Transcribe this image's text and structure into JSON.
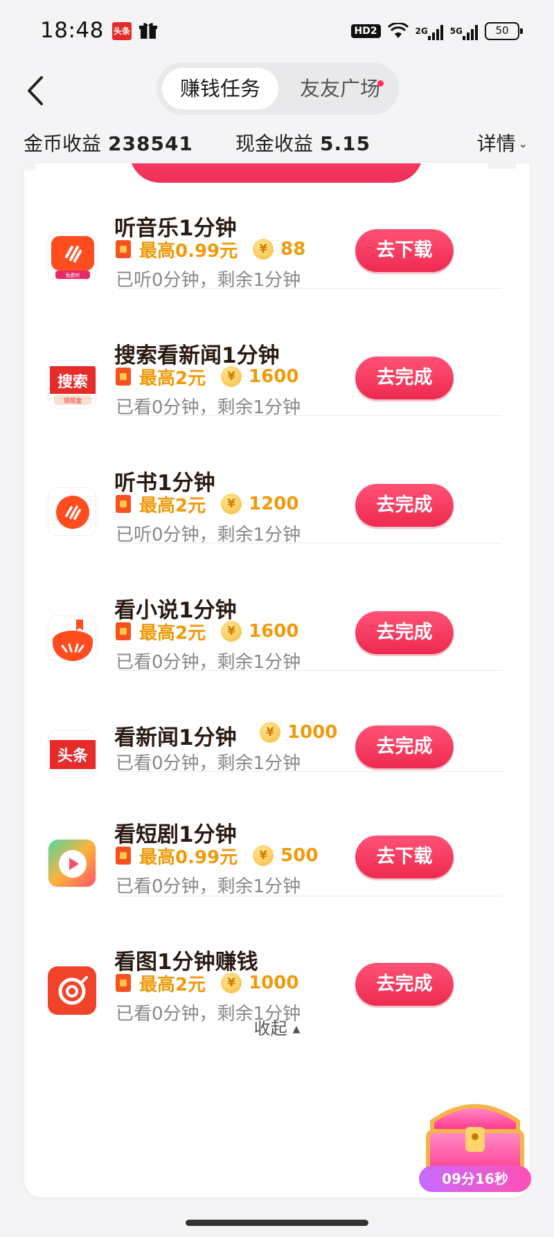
{
  "status_bar": {
    "time": "18:48",
    "app_badge": "头条",
    "hd_label": "HD2",
    "signal1_label": "2G",
    "signal2_label": "5G",
    "battery_level": "50"
  },
  "header": {
    "tabs": [
      {
        "label": "赚钱任务",
        "active": true
      },
      {
        "label": "友友广场",
        "active": false,
        "has_dot": true
      }
    ],
    "coin_earnings_label": "金币收益",
    "coin_earnings_value": "238541",
    "cash_earnings_label": "现金收益",
    "cash_earnings_value": "5.15",
    "details_label": "详情"
  },
  "tasks": [
    {
      "title": "听音乐1分钟",
      "reward_cash": "最高0.99元",
      "reward_coins": "88",
      "progress": "已听0分钟，剩余1分钟",
      "button": "去下载",
      "icon": "music-app-icon",
      "icon_text": "免费听"
    },
    {
      "title": "搜索看新闻1分钟",
      "reward_cash": "最高2元",
      "reward_coins": "1600",
      "progress": "已看0分钟，剩余1分钟",
      "button": "去完成",
      "icon": "search-app-icon",
      "icon_text": "搜索",
      "icon_subtext": "领现金"
    },
    {
      "title": "听书1分钟",
      "reward_cash": "最高2元",
      "reward_coins": "1200",
      "progress": "已听0分钟，剩余1分钟",
      "button": "去完成",
      "icon": "audiobook-app-icon"
    },
    {
      "title": "看小说1分钟",
      "reward_cash": "最高2元",
      "reward_coins": "1600",
      "progress": "已看0分钟，剩余1分钟",
      "button": "去完成",
      "icon": "novel-app-icon"
    },
    {
      "title": "看新闻1分钟",
      "reward_cash": "",
      "reward_coins": "1000",
      "progress": "已看0分钟，剩余1分钟",
      "button": "去完成",
      "icon": "news-app-icon",
      "icon_text": "头条"
    },
    {
      "title": "看短剧1分钟",
      "reward_cash": "最高0.99元",
      "reward_coins": "500",
      "progress": "已看0分钟，剩余1分钟",
      "button": "去下载",
      "icon": "short-drama-app-icon"
    },
    {
      "title": "看图1分钟赚钱",
      "reward_cash": "最高2元",
      "reward_coins": "1000",
      "progress": "已看0分钟，剩余1分钟",
      "button": "去完成",
      "icon": "photo-app-icon"
    }
  ],
  "collapse_label": "收起",
  "treasure_chest": {
    "timer": "09分16秒"
  },
  "colors": {
    "accent": "#f02f58",
    "reward": "#ef9a0a",
    "background": "#f4f4f6"
  }
}
